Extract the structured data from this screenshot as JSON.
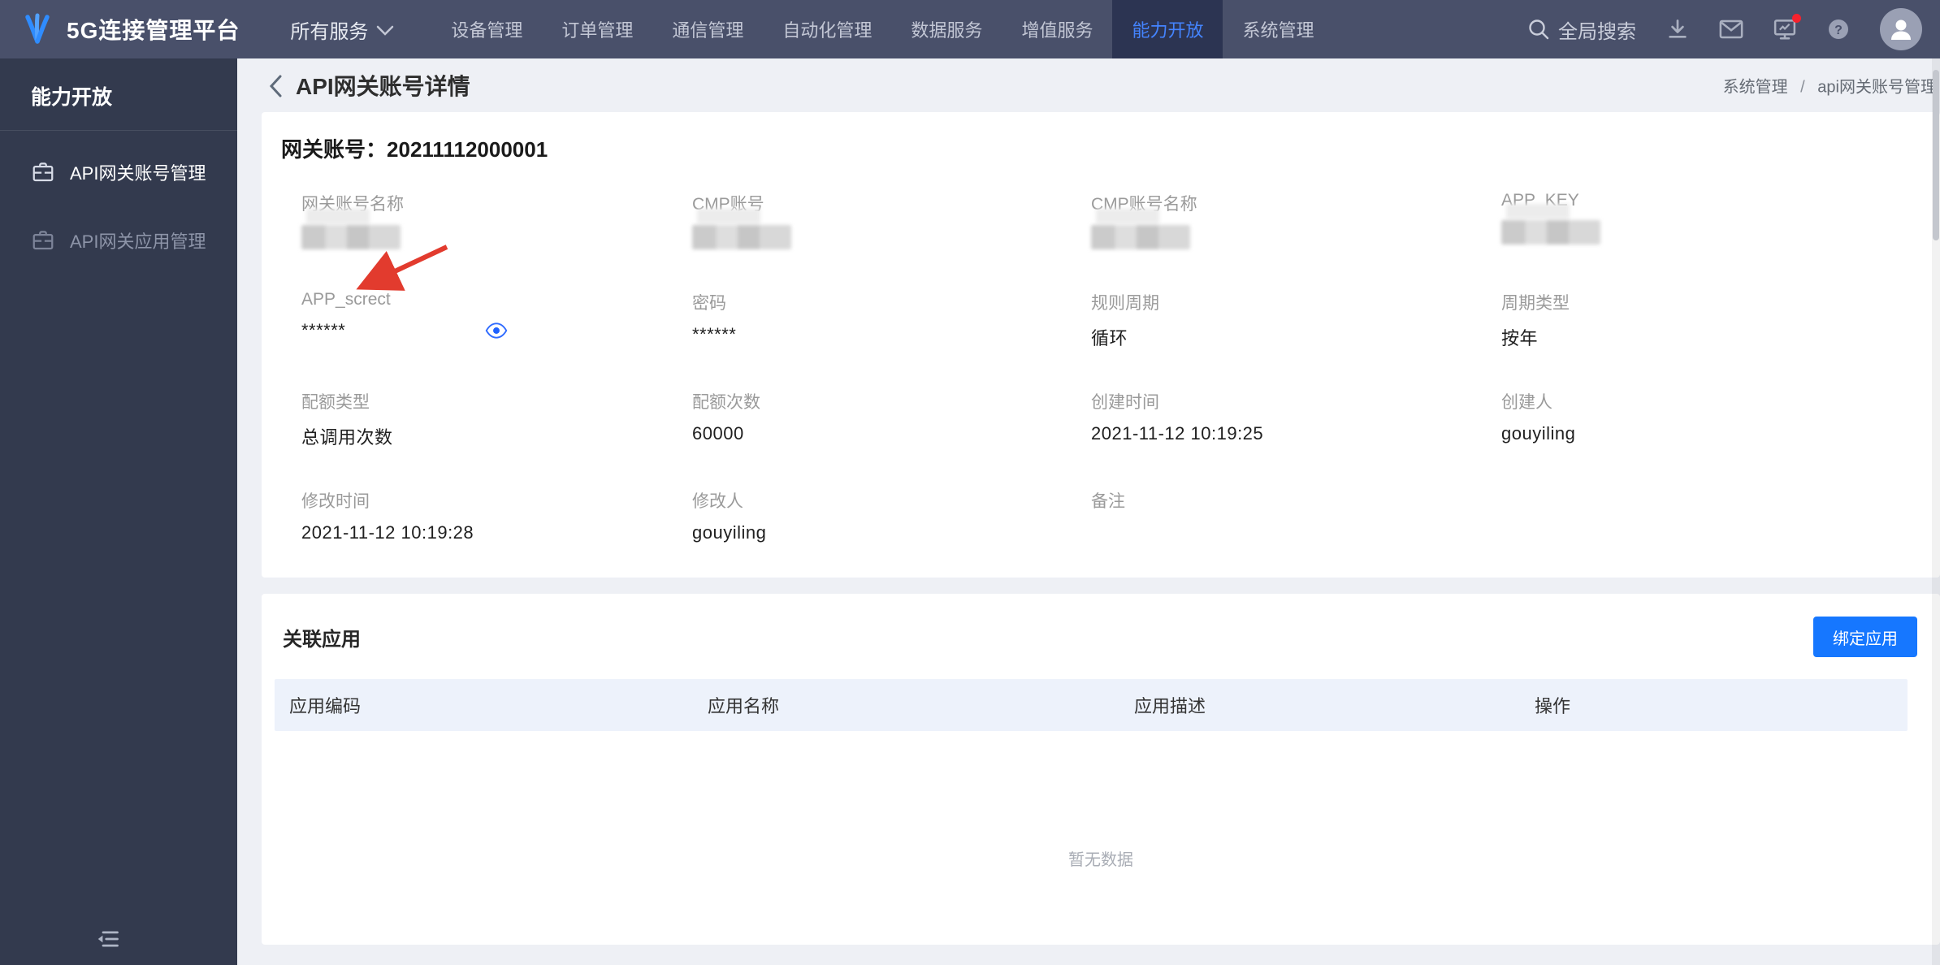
{
  "topbar": {
    "brand": "5G连接管理平台",
    "all_services_label": "所有服务",
    "nav_items": [
      {
        "label": "设备管理"
      },
      {
        "label": "订单管理"
      },
      {
        "label": "通信管理"
      },
      {
        "label": "自动化管理"
      },
      {
        "label": "数据服务"
      },
      {
        "label": "增值服务"
      },
      {
        "label": "能力开放",
        "active": true
      },
      {
        "label": "系统管理"
      }
    ],
    "search_label": "全局搜索"
  },
  "sidebar": {
    "title": "能力开放",
    "items": [
      {
        "label": "API网关账号管理",
        "active": true
      },
      {
        "label": "API网关应用管理"
      }
    ]
  },
  "page": {
    "title": "API网关账号详情",
    "breadcrumb_separator": "/",
    "breadcrumb": [
      {
        "label": "系统管理"
      },
      {
        "label": "api网关账号管理"
      }
    ]
  },
  "account_card": {
    "title_label": "网关账号",
    "title_separator": "：",
    "title_value": "20211112000001",
    "fields": [
      {
        "label": "网关账号名称",
        "redacted": true
      },
      {
        "label": "CMP账号",
        "redacted": true
      },
      {
        "label": "CMP账号名称",
        "redacted": true
      },
      {
        "label": "APP_KEY",
        "redacted": true
      },
      {
        "label": "APP_screct",
        "value": "******",
        "eye": true
      },
      {
        "label": "密码",
        "value": "******"
      },
      {
        "label": "规则周期",
        "value": "循环"
      },
      {
        "label": "周期类型",
        "value": "按年"
      },
      {
        "label": "配额类型",
        "value": "总调用次数"
      },
      {
        "label": "配额次数",
        "value": "60000"
      },
      {
        "label": "创建时间",
        "value": "2021-11-12 10:19:25"
      },
      {
        "label": "创建人",
        "value": "gouyiling"
      },
      {
        "label": "修改时间",
        "value": "2021-11-12 10:19:28"
      },
      {
        "label": "修改人",
        "value": "gouyiling"
      },
      {
        "label": "备注",
        "value": ""
      }
    ]
  },
  "related_card": {
    "title": "关联应用",
    "bind_button_label": "绑定应用",
    "columns": [
      {
        "label": "应用编码"
      },
      {
        "label": "应用名称"
      },
      {
        "label": "应用描述"
      },
      {
        "label": "操作"
      }
    ],
    "empty_text": "暂无数据"
  },
  "colors": {
    "accent_blue": "#1677ff",
    "active_nav_blue": "#4484ff",
    "arrow_red": "#e23b2e"
  }
}
